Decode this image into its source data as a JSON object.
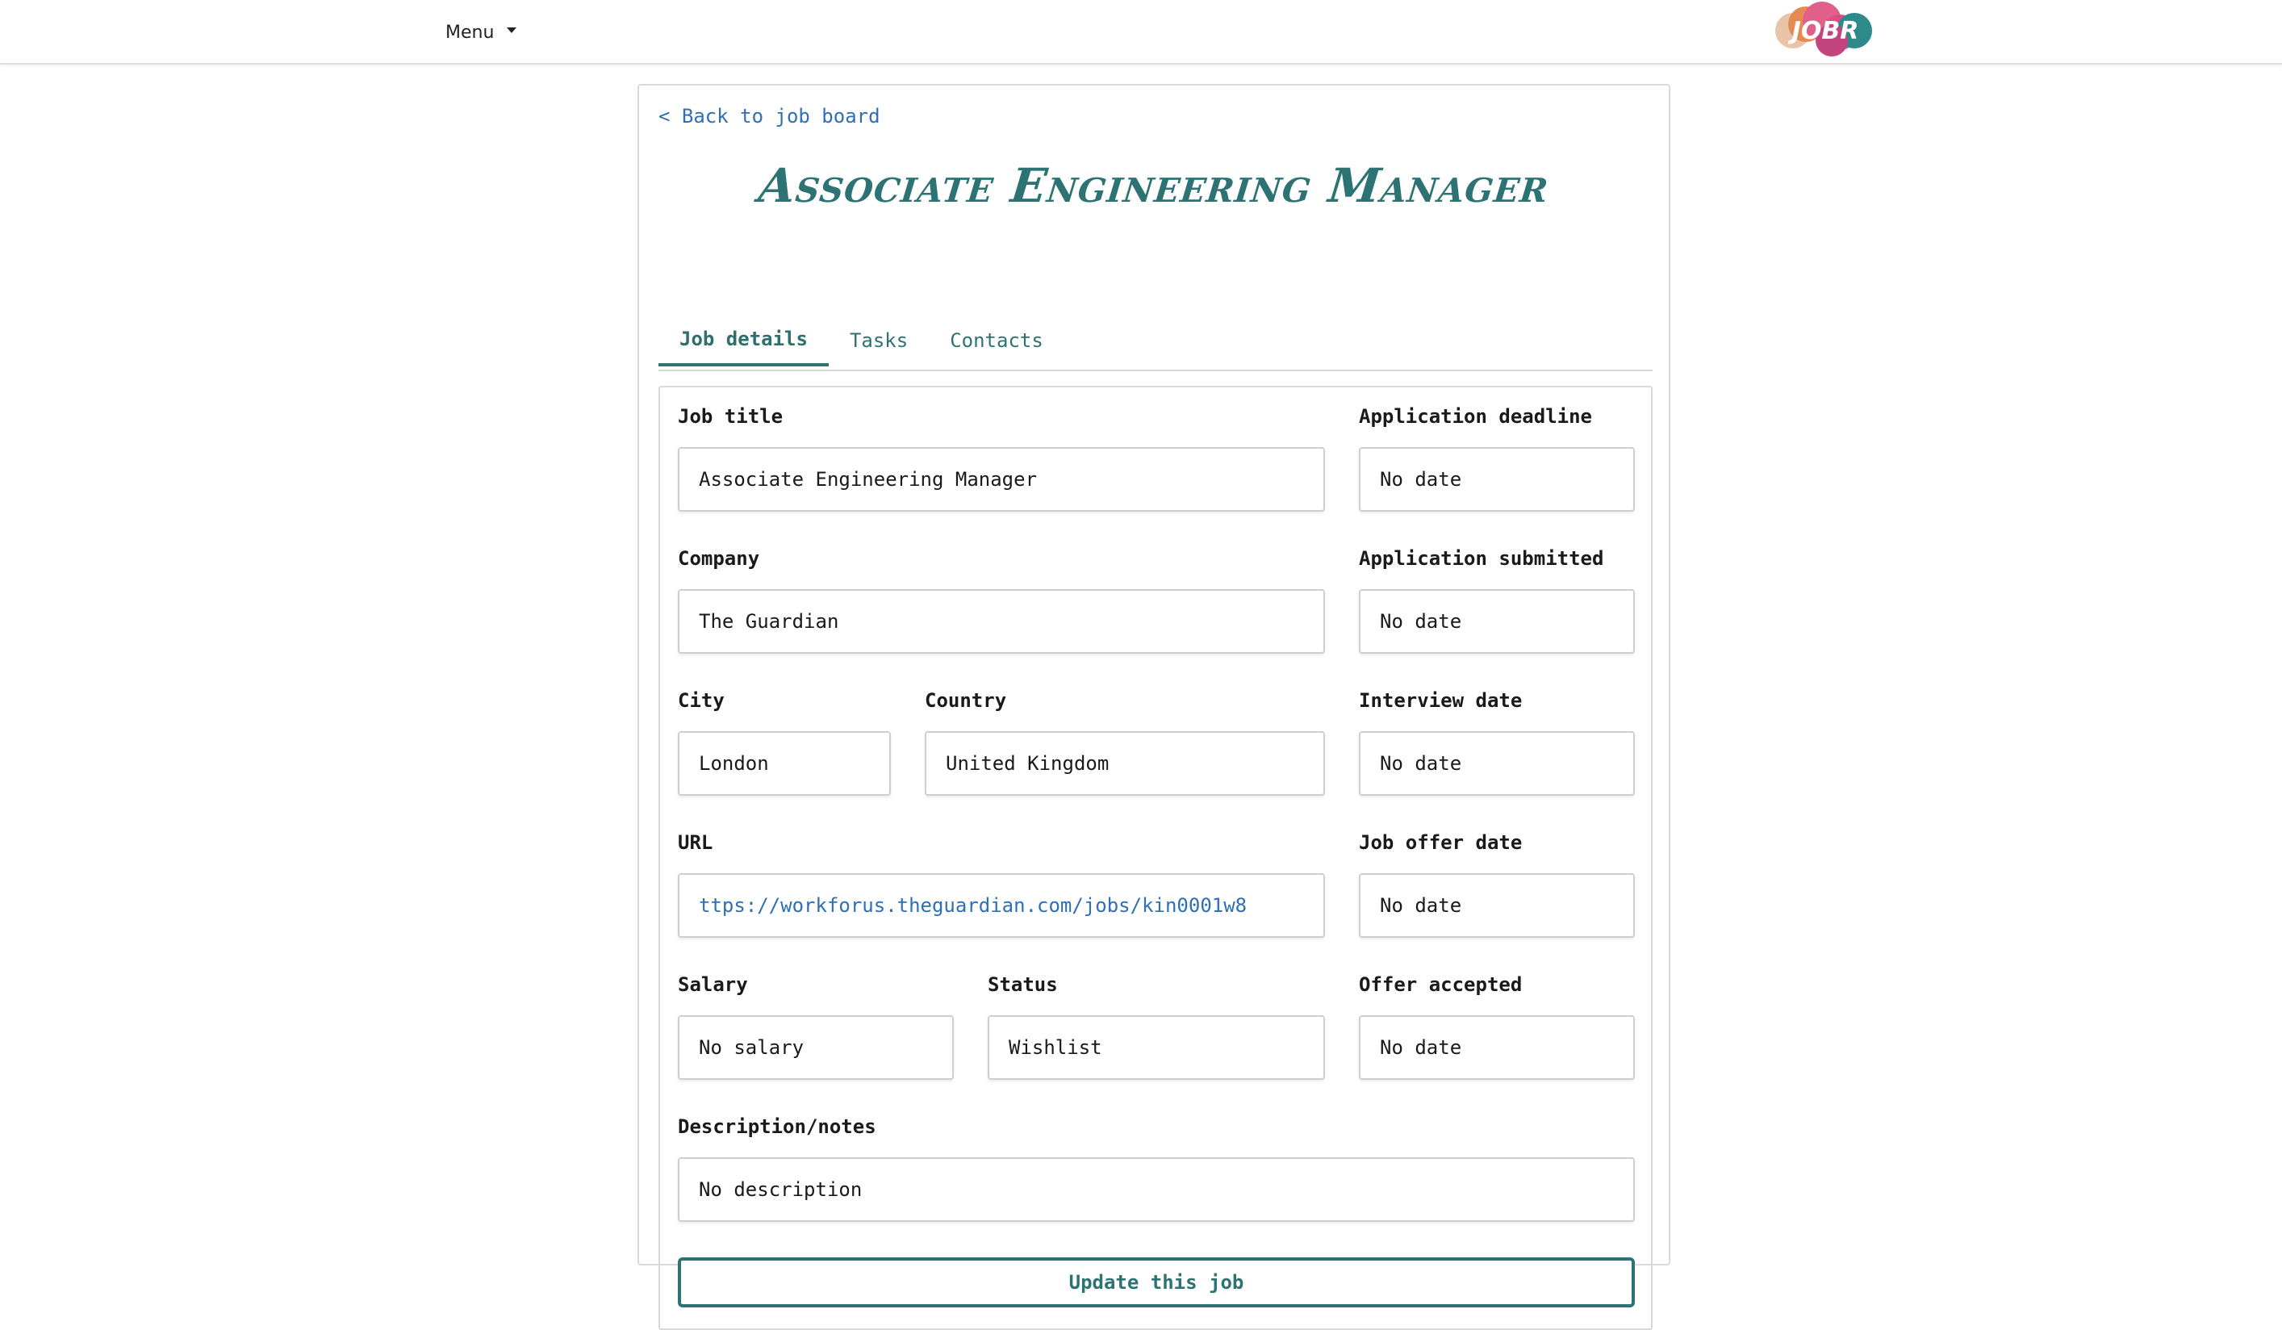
{
  "nav": {
    "menu_label": "Menu",
    "logo_text": "JOBR"
  },
  "card": {
    "back_link": "< Back to job board",
    "title": "Associate Engineering Manager"
  },
  "tabs": [
    {
      "label": "Job details",
      "active": true
    },
    {
      "label": "Tasks",
      "active": false
    },
    {
      "label": "Contacts",
      "active": false
    }
  ],
  "form": {
    "job_title": {
      "label": "Job title",
      "value": "Associate Engineering Manager"
    },
    "company": {
      "label": "Company",
      "value": "The Guardian"
    },
    "city": {
      "label": "City",
      "value": "London"
    },
    "country": {
      "label": "Country",
      "value": "United Kingdom"
    },
    "url": {
      "label": "URL",
      "value": "ttps://workforus.theguardian.com/jobs/kin0001w8"
    },
    "salary": {
      "label": "Salary",
      "value": "No salary"
    },
    "status": {
      "label": "Status",
      "value": "Wishlist"
    },
    "description": {
      "label": "Description/notes",
      "value": "No description"
    },
    "application_deadline": {
      "label": "Application deadline",
      "value": "No date"
    },
    "application_submitted": {
      "label": "Application submitted",
      "value": "No date"
    },
    "interview_date": {
      "label": "Interview date",
      "value": "No date"
    },
    "job_offer_date": {
      "label": "Job offer date",
      "value": "No date"
    },
    "offer_accepted": {
      "label": "Offer accepted",
      "value": "No date"
    },
    "update_button": "Update this job"
  },
  "colors": {
    "accent": "#2e7374",
    "link": "#2f6fb3",
    "border": "#d9d9d9"
  }
}
